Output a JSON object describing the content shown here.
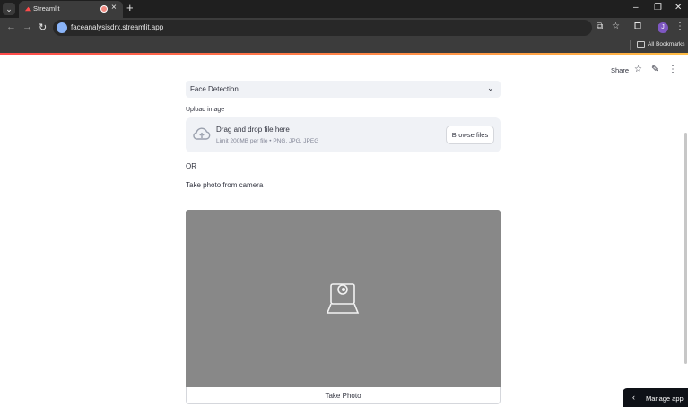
{
  "browser": {
    "tab_title": "Streamlit",
    "tab_close": "×",
    "new_tab": "+",
    "url": "faceanalysisdrx.streamlit.app",
    "bookmarks_label": "All Bookmarks",
    "profile_initial": "J",
    "window_controls": {
      "minimize": "–",
      "restore": "❐",
      "close": "✕"
    },
    "nav": {
      "back": "←",
      "forward": "→",
      "reload": "↻"
    },
    "toolbar_icons": {
      "cast": "⧉",
      "star": "☆",
      "extensions": "⧠",
      "menu": "⋮"
    }
  },
  "header": {
    "share_label": "Share",
    "star_icon": "☆",
    "edit_icon": "✎",
    "menu_icon": "⋮"
  },
  "main": {
    "selectbox": {
      "value": "Face Detection",
      "chevron": "⌄"
    },
    "uploader": {
      "label": "Upload image",
      "dropzone_title": "Drag and drop file here",
      "limit_text": "Limit 200MB per file • PNG, JPG, JPEG",
      "browse_button": "Browse files"
    },
    "or_text": "OR",
    "camera": {
      "label": "Take photo from camera",
      "take_photo_button": "Take Photo"
    }
  },
  "footer": {
    "manage_app": "Manage app",
    "chevron": "‹"
  },
  "colors": {
    "accent_gradient_start": "#ff4b4b",
    "accent_gradient_end": "#ffbd45",
    "input_bg": "#f0f2f6",
    "camera_bg": "#888888"
  }
}
